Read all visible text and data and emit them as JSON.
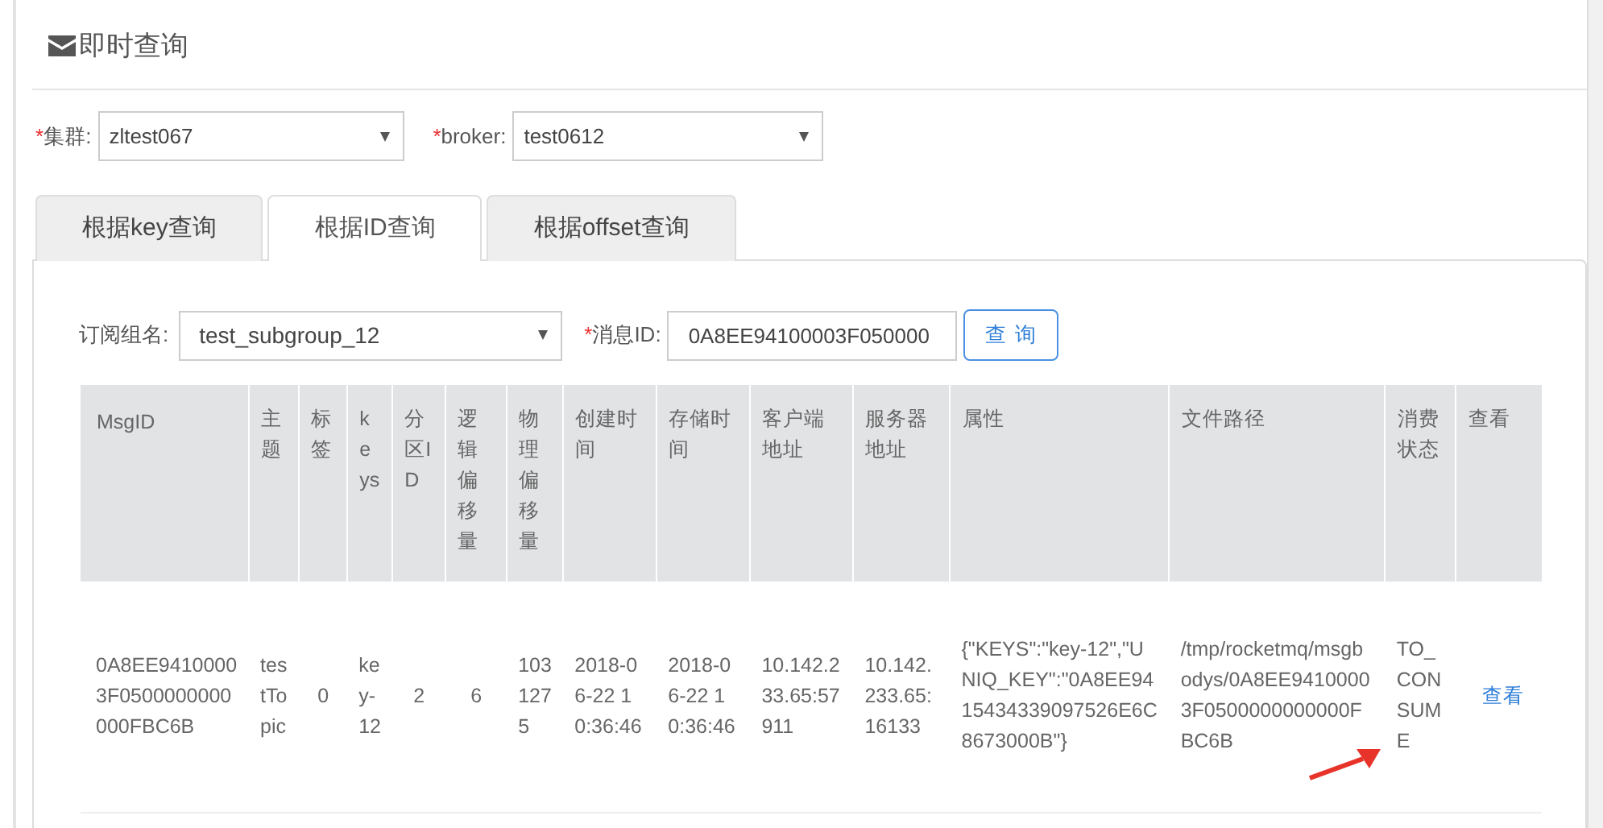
{
  "page_title": "即时查询",
  "filters": [
    {
      "mark": "*",
      "label": "集群:",
      "value": "zltest067"
    },
    {
      "mark": "*",
      "label": "broker:",
      "value": "test0612"
    }
  ],
  "tabs": [
    {
      "label": "根据key查询",
      "selected": false
    },
    {
      "label": "根据ID查询",
      "selected": true
    },
    {
      "label": "根据offset查询",
      "selected": false
    }
  ],
  "query": {
    "group_label": "订阅组名:",
    "group_value": "test_subgroup_12",
    "id_mark": "*",
    "id_label": "消息ID:",
    "id_value": "0A8EE94100003F050000",
    "button": "查 询"
  },
  "table": {
    "columns": [
      "MsgID",
      "主题",
      "标签",
      "keys",
      "分区ID",
      "逻辑偏移量",
      "物理偏移量",
      "创建时间",
      "存储时间",
      "客户端地址",
      "服务器地址",
      "属性",
      "文件路径",
      "消费状态",
      "查看"
    ],
    "rows": [
      {
        "cells": [
          "0A8EE94100003F0500000000000FBC6B",
          "testTopic",
          "0",
          "key-12",
          "2",
          "6",
          "1031275",
          "2018-06-22 10:36:46",
          "2018-06-22 10:36:46",
          "10.142.233.65:57911",
          "10.142.233.65:16133",
          "{\"KEYS\":\"key-12\",\"UNIQ_KEY\":\"0A8EE9415434339097526E6C8673000B\"}",
          "/tmp/rocketmq/msgbodys/0A8EE94100003F0500000000000FBC6B",
          "TO_CONSUME"
        ],
        "action": "查看"
      }
    ]
  }
}
